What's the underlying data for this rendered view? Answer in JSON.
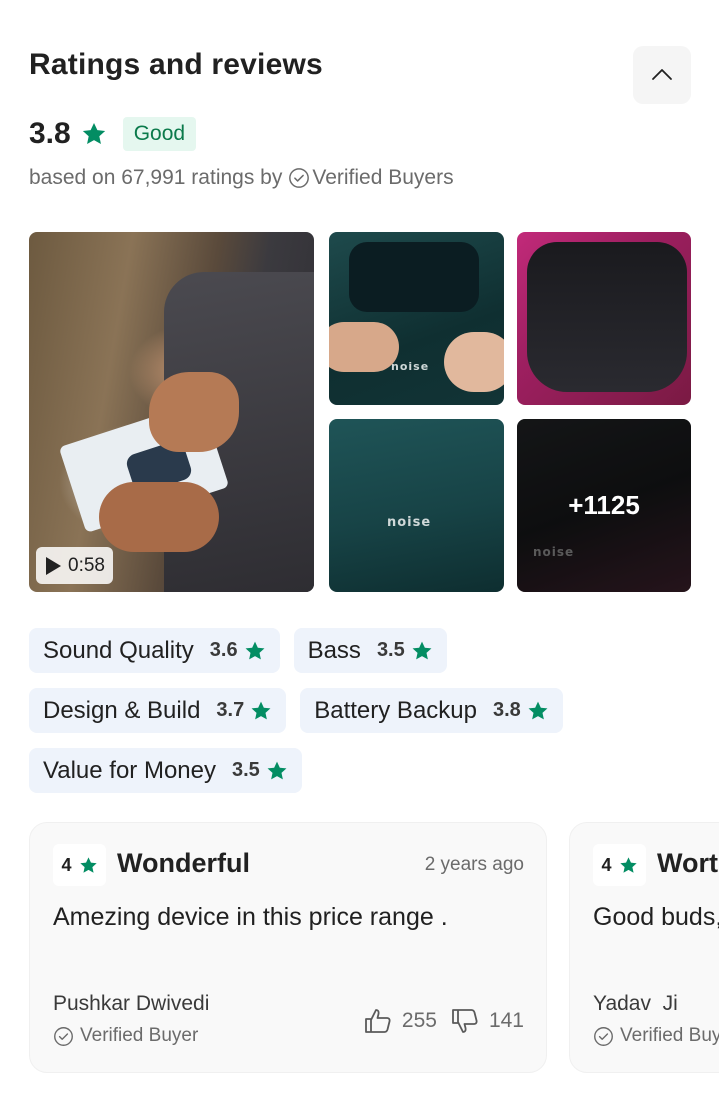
{
  "header": {
    "title": "Ratings and reviews",
    "collapse_icon": "chevron-up-icon"
  },
  "summary": {
    "score": "3.8",
    "badge": "Good",
    "based_on_prefix": "based on 67,991 ratings by",
    "verified_label": "Verified Buyers",
    "star_color": "#038d63"
  },
  "media": {
    "video_duration": "0:58",
    "more_count": "+1125",
    "logo_text": "noise"
  },
  "aspects": [
    {
      "name": "Sound Quality",
      "rating": "3.6"
    },
    {
      "name": "Bass",
      "rating": "3.5"
    },
    {
      "name": "Design & Build",
      "rating": "3.7"
    },
    {
      "name": "Battery Backup",
      "rating": "3.8"
    },
    {
      "name": "Value for Money",
      "rating": "3.5"
    }
  ],
  "reviews": [
    {
      "rating": "4",
      "title": "Wonderful",
      "time": "2 years ago",
      "text": "Amezing device in this price range .",
      "author": "Pushkar Dwivedi",
      "verified": "Verified Buyer",
      "likes": "255",
      "dislikes": "141"
    },
    {
      "rating": "4",
      "title": "Worth the money",
      "time": "",
      "text": "Good buds, sound quality is awesome",
      "author": "Yadav  Ji",
      "verified": "Verified Buyer",
      "likes": "",
      "dislikes": ""
    }
  ]
}
